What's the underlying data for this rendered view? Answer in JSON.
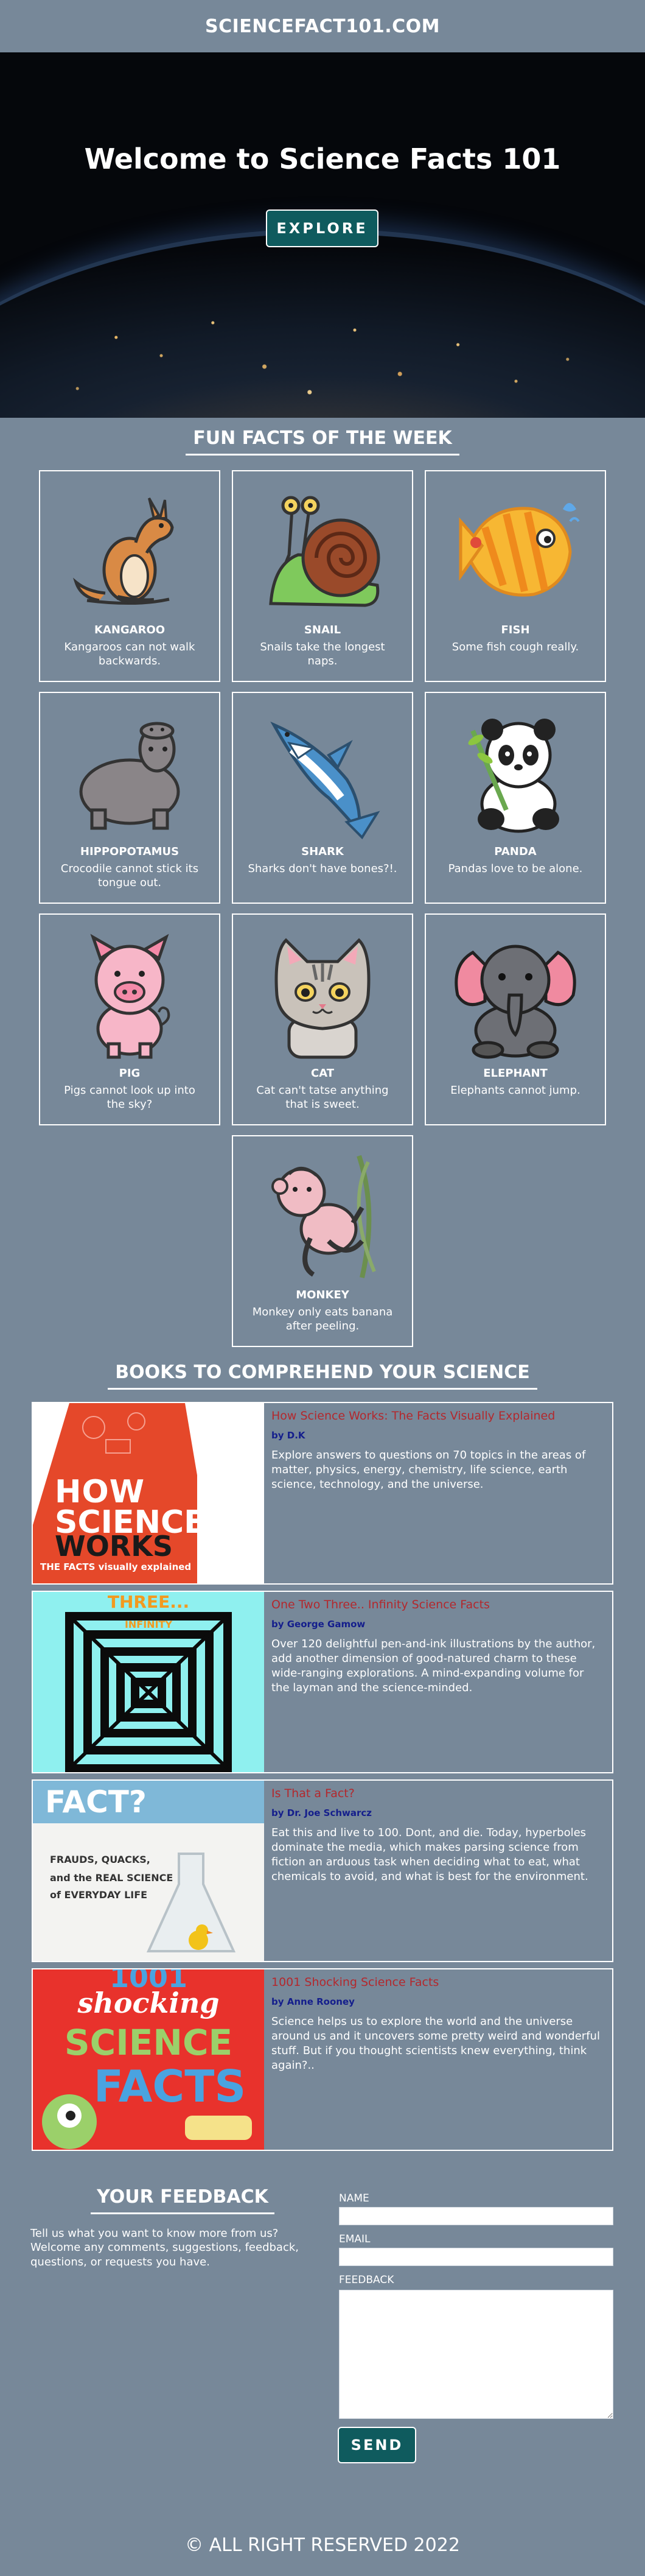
{
  "header": {
    "site_title": "SCIENCEFACT101.COM"
  },
  "hero": {
    "heading": "Welcome to Science Facts 101",
    "button_label": "EXPLORE"
  },
  "facts_section": {
    "title": "FUN FACTS OF THE WEEK",
    "items": [
      {
        "name": "KANGAROO",
        "fact": "Kangaroos can not walk backwards.",
        "icon": "kangaroo-icon"
      },
      {
        "name": "SNAIL",
        "fact": "Snails take the longest naps.",
        "icon": "snail-icon"
      },
      {
        "name": "FISH",
        "fact": "Some fish cough really.",
        "icon": "fish-icon"
      },
      {
        "name": "HIPPOPOTAMUS",
        "fact": "Crocodile cannot stick its tongue out.",
        "icon": "hippopotamus-icon"
      },
      {
        "name": "SHARK",
        "fact": "Sharks don't have bones?!.",
        "icon": "shark-icon"
      },
      {
        "name": "PANDA",
        "fact": "Pandas love to be alone.",
        "icon": "panda-icon"
      },
      {
        "name": "PIG",
        "fact": "Pigs cannot look up into the sky?",
        "icon": "pig-icon"
      },
      {
        "name": "CAT",
        "fact": "Cat can't tatse anything that is sweet.",
        "icon": "cat-icon"
      },
      {
        "name": "ELEPHANT",
        "fact": "Elephants cannot jump.",
        "icon": "elephant-icon"
      },
      {
        "name": "MONKEY",
        "fact": "Monkey only eats banana after peeling.",
        "icon": "monkey-icon"
      }
    ]
  },
  "books_section": {
    "title": "BOOKS TO COMPREHEND YOUR SCIENCE",
    "books": [
      {
        "title": "How Science Works: The Facts Visually Explained",
        "author": "by D.K",
        "description": "Explore answers to questions on 70 topics in the areas of matter, physics, energy, chemistry, life science, earth science, technology, and the universe.",
        "cover_lines": [
          "HOW",
          "SCIENCE",
          "WORKS",
          "THE FACTS visually explained"
        ]
      },
      {
        "title": "One Two Three.. Infinity Science Facts",
        "author": "by George Gamow",
        "description": "Over 120 delightful pen-and-ink illustrations by the author, add another dimension of good-natured charm to these wide-ranging explorations. A mind-expanding volume for the layman and the science-minded.",
        "cover_lines": [
          "THREE...",
          "INFINITY"
        ]
      },
      {
        "title": "Is That a Fact?",
        "author": "by Dr. Joe Schwarcz",
        "description": "Eat this and live to 100. Dont, and die. Today, hyperboles dominate the media, which makes parsing science from fiction an arduous task when deciding what to eat, what chemicals to avoid, and what is best for the environment.",
        "cover_lines": [
          "FACT?",
          "FRAUDS, QUACKS,",
          "and the REAL SCIENCE",
          "of EVERYDAY LIFE"
        ]
      },
      {
        "title": "1001 Shocking Science Facts",
        "author": "by Anne Rooney",
        "description": "Science helps us to explore the world and the universe around us and it uncovers some pretty weird and wonderful stuff. But if you thought scientists knew everything, think again?..",
        "cover_lines": [
          "1001",
          "shocking",
          "SCIENCE",
          "FACTS"
        ]
      }
    ]
  },
  "feedback": {
    "title": "YOUR FEEDBACK",
    "text": "Tell us what you want to know more from us? Welcome any comments, suggestions, feedback, questions, or requests you have.",
    "name_label": "NAME",
    "email_label": "EMAIL",
    "feedback_label": "FEEDBACK",
    "send_label": "SEND"
  },
  "footer": {
    "copyright": "© ALL RIGHT RESERVED 2022"
  },
  "colors": {
    "background": "#778899",
    "button": "#0f5b5e",
    "book_title": "#b3282d",
    "book_author": "#141e8c"
  }
}
